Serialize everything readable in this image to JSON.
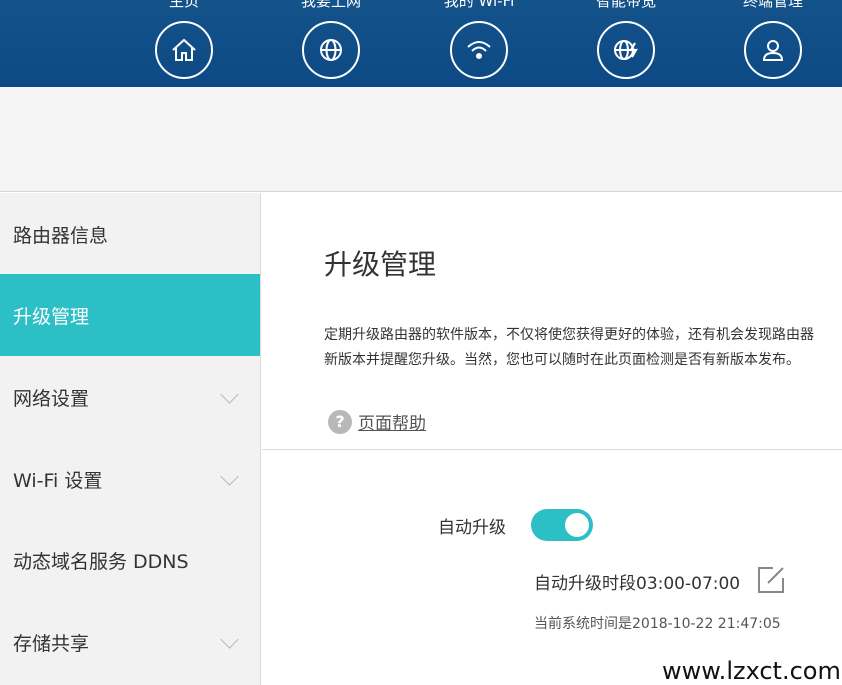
{
  "topnav": {
    "items": [
      {
        "label": "主页",
        "icon": "home-icon"
      },
      {
        "label": "我要上网",
        "icon": "globe-icon"
      },
      {
        "label": "我的 Wi-Fi",
        "icon": "wifi-icon"
      },
      {
        "label": "智能带宽",
        "icon": "bandwidth-icon"
      },
      {
        "label": "终端管理",
        "icon": "user-icon"
      }
    ]
  },
  "sidebar": {
    "items": [
      {
        "label": "路由器信息",
        "active": false,
        "expandable": false
      },
      {
        "label": "升级管理",
        "active": true,
        "expandable": false
      },
      {
        "label": "网络设置",
        "active": false,
        "expandable": true
      },
      {
        "label": "Wi-Fi 设置",
        "active": false,
        "expandable": true
      },
      {
        "label": "动态域名服务 DDNS",
        "active": false,
        "expandable": false
      },
      {
        "label": "存储共享",
        "active": false,
        "expandable": true
      }
    ]
  },
  "main": {
    "title": "升级管理",
    "description_line1": "定期升级路由器的软件版本，不仅将使您获得更好的体验，还有机会发现路由器",
    "description_line2": "新版本并提醒您升级。当然，您也可以随时在此页面检测是否有新版本发布。",
    "help_icon_glyph": "?",
    "help_text": "页面帮助",
    "auto_upgrade_label": "自动升级",
    "auto_upgrade_enabled": true,
    "upgrade_period": "自动升级时段03:00-07:00",
    "system_time": "当前系统时间是2018-10-22 21:47:05"
  },
  "watermark": "www.lzxct.com",
  "colors": {
    "nav_bg": "#0d4a85",
    "accent": "#2dbfc6",
    "sidebar_bg": "#f2f2f2"
  }
}
